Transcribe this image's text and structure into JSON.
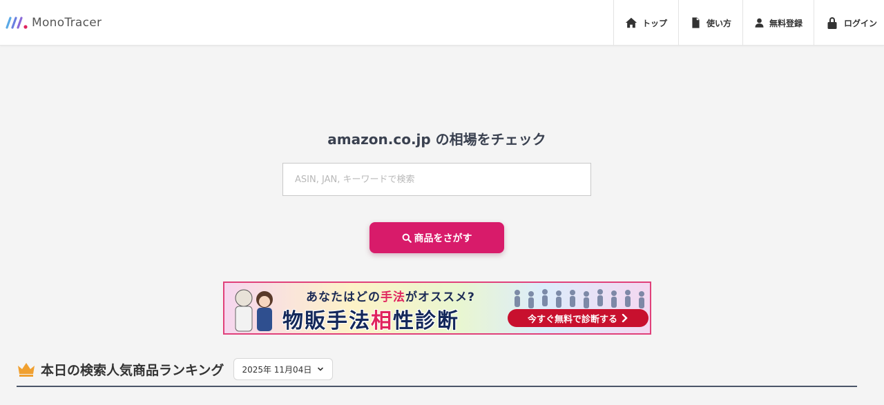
{
  "header": {
    "logo_text": "MonoTracer",
    "nav": [
      {
        "label": "トップ",
        "icon": "home-icon"
      },
      {
        "label": "使い方",
        "icon": "document-icon"
      },
      {
        "label": "無料登録",
        "icon": "user-icon"
      },
      {
        "label": "ログイン",
        "icon": "lock-icon"
      }
    ]
  },
  "search": {
    "headline": "amazon.co.jp の相場をチェック",
    "placeholder": "ASIN, JAN, キーワードで検索",
    "value": "",
    "button_label": "商品をさがす",
    "button_color": "#d81b6a"
  },
  "banner": {
    "subtitle_pre": "あなたはどの",
    "subtitle_hl": "手法",
    "subtitle_post": "がオススメ?",
    "title_pre": "物販手法",
    "title_hl": "相",
    "title_post": "性診断",
    "cta": "今すぐ無料で診断する",
    "accent": "#e0245e"
  },
  "ranking": {
    "title": "本日の検索人気商品ランキング",
    "date": "2025年 11月04日",
    "crown_color": "#f0a030"
  }
}
